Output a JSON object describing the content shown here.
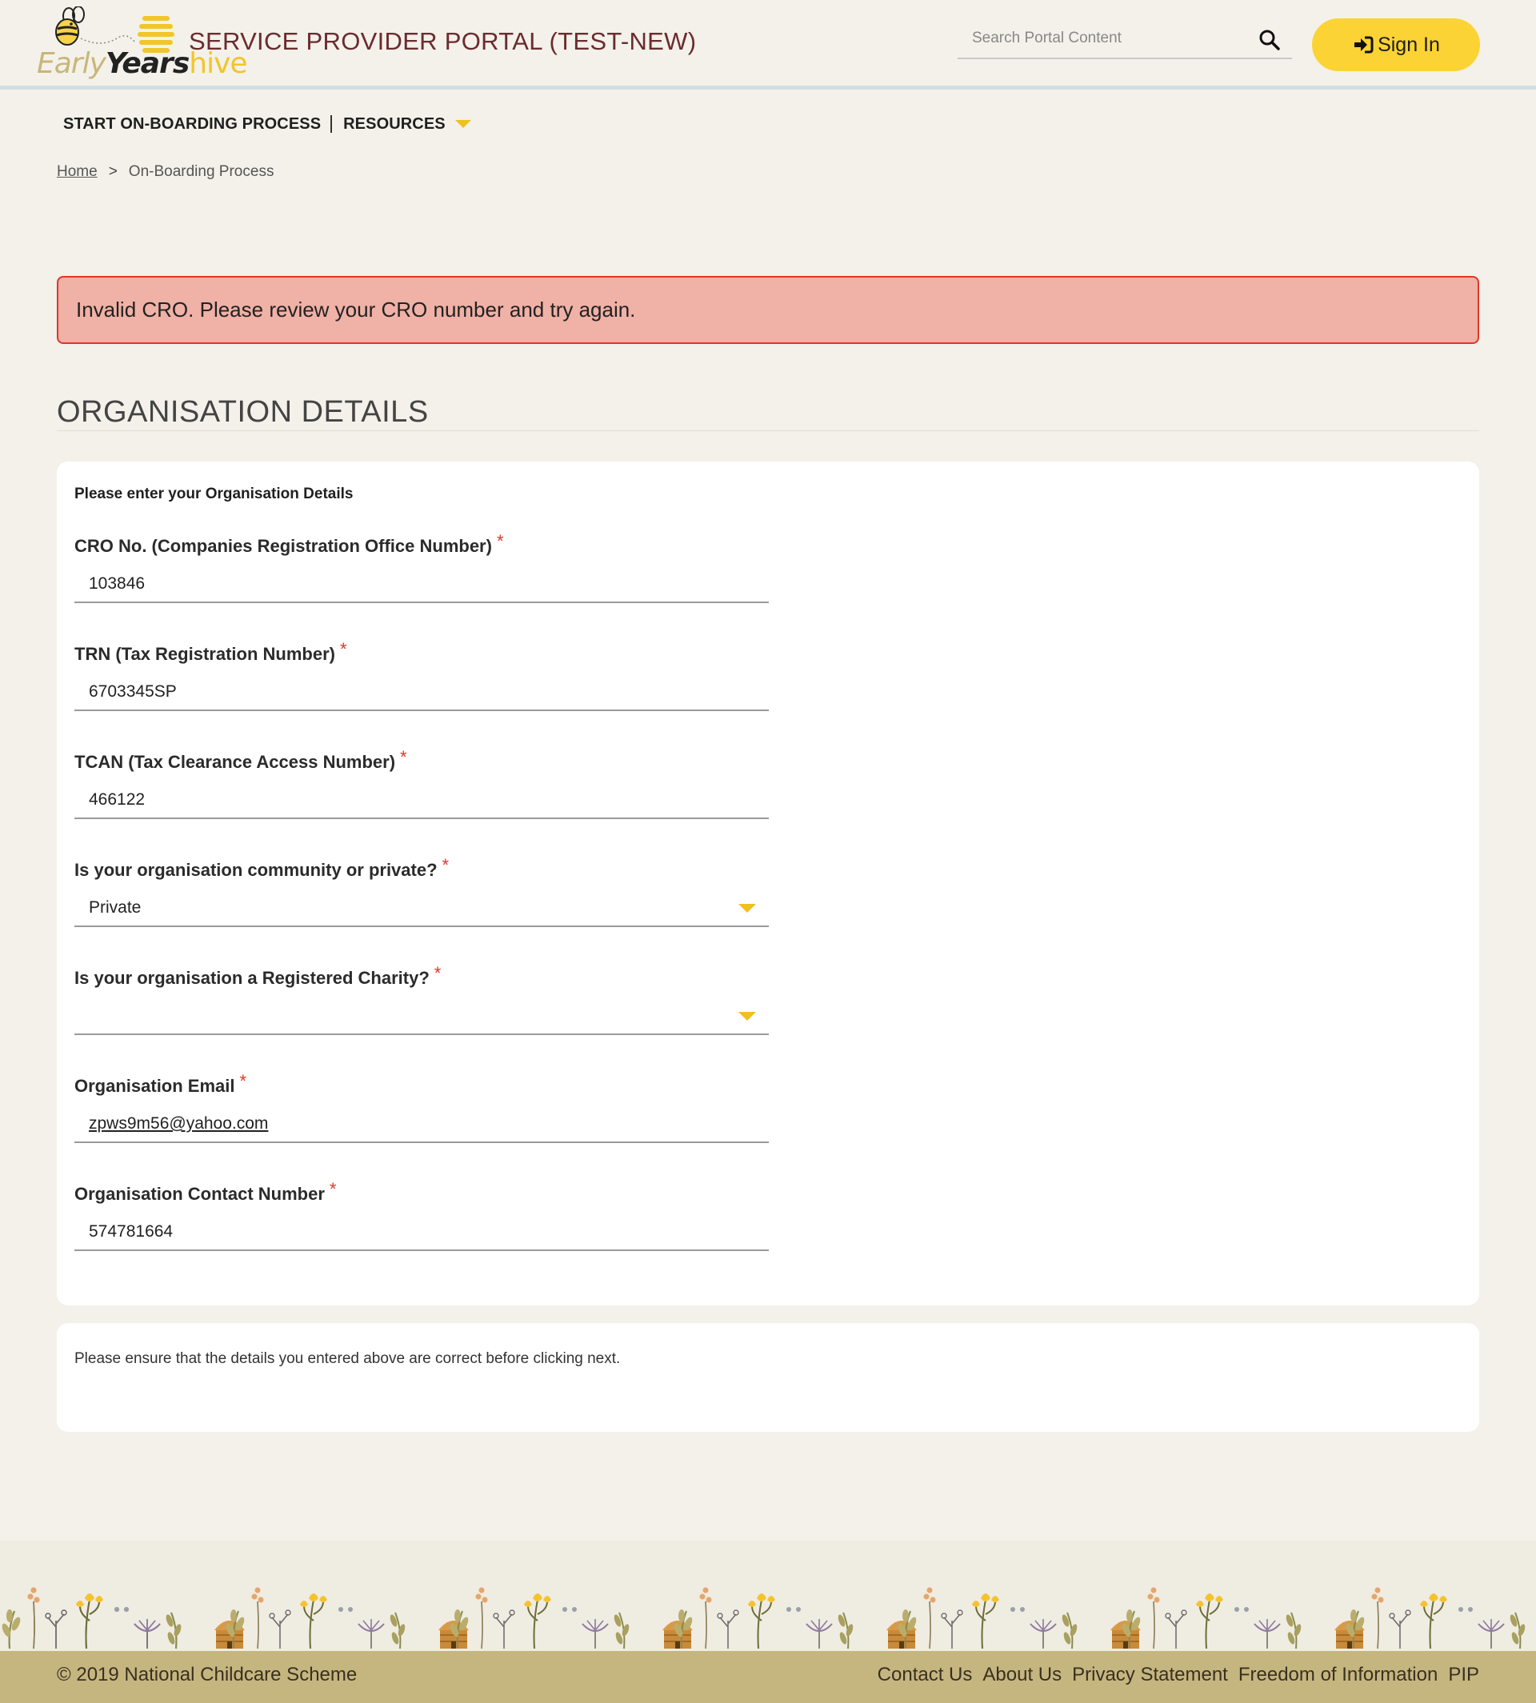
{
  "header": {
    "logo": {
      "early": "Early",
      "years": "Years",
      "hive": "hive"
    },
    "portal_title": "SERVICE PROVIDER PORTAL (TEST-NEW)",
    "search_placeholder": "Search Portal Content",
    "signin_label": "Sign In"
  },
  "nav": {
    "items": [
      {
        "label": "START ON-BOARDING PROCESS"
      },
      {
        "label": "RESOURCES"
      }
    ]
  },
  "breadcrumb": {
    "home": "Home",
    "separator": ">",
    "current": "On-Boarding Process"
  },
  "alert": {
    "message": "Invalid CRO. Please review your CRO number and try again."
  },
  "section": {
    "title": "ORGANISATION DETAILS"
  },
  "form": {
    "intro": "Please enter your Organisation Details",
    "required_marker": "*",
    "fields": [
      {
        "label": "CRO No. (Companies Registration Office Number)",
        "value": "103846"
      },
      {
        "label": "TRN (Tax Registration Number)",
        "value": "6703345SP"
      },
      {
        "label": "TCAN (Tax Clearance Access Number)",
        "value": "466122"
      },
      {
        "label": "Is your organisation community or private?",
        "value": "Private"
      },
      {
        "label": "Is your organisation a Registered Charity?",
        "value": ""
      },
      {
        "label": "Organisation Email",
        "value": "zpws9m56@yahoo.com"
      },
      {
        "label": "Organisation Contact Number",
        "value": "574781664"
      }
    ]
  },
  "notice": {
    "text": "Please ensure that the details you entered above are correct before clicking next."
  },
  "footer": {
    "copyright": "© 2019 National Childcare Scheme",
    "links": [
      {
        "label": "Contact Us"
      },
      {
        "label": "About Us"
      },
      {
        "label": "Privacy Statement"
      },
      {
        "label": "Freedom of Information"
      },
      {
        "label": "PIP"
      }
    ]
  },
  "colors": {
    "background": "#f3f1ea",
    "brand_yellow": "#fcd334",
    "title_maroon": "#6b2b2f",
    "alert_bg": "#f0b1a6",
    "alert_border": "#e0362a",
    "footer": "#c5b680"
  },
  "icons": {
    "search": "search-icon",
    "signin": "sign-in-icon",
    "dropdown": "caret-down-icon",
    "bee": "bee-icon"
  }
}
